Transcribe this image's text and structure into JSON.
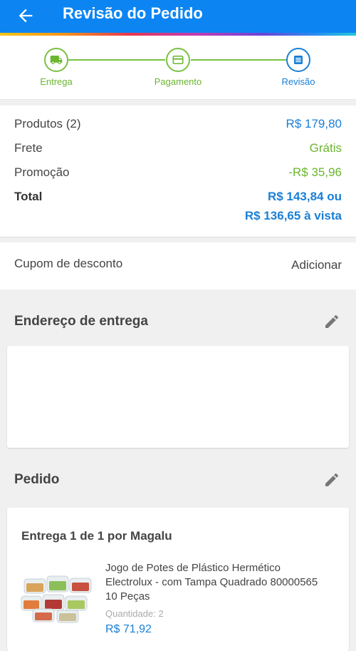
{
  "header": {
    "title": "Revisão do Pedido",
    "back_icon": "arrow-left-icon"
  },
  "steps": [
    {
      "label": "Entrega",
      "icon": "truck-icon",
      "state": "done"
    },
    {
      "label": "Pagamento",
      "icon": "credit-card-icon",
      "state": "done"
    },
    {
      "label": "Revisão",
      "icon": "list-icon",
      "state": "current"
    }
  ],
  "summary": {
    "products_label": "Produtos (2)",
    "products_value": "R$ 179,80",
    "shipping_label": "Frete",
    "shipping_value": "Grátis",
    "promo_label": "Promoção",
    "promo_value": "-R$ 35,96",
    "total_label": "Total",
    "total_value_line1": "R$ 143,84 ou",
    "total_value_line2": "R$ 136,65 à vista"
  },
  "coupon": {
    "label": "Cupom de desconto",
    "action": "Adicionar"
  },
  "address_section": {
    "title": "Endereço de entrega"
  },
  "order_section": {
    "title": "Pedido"
  },
  "order": {
    "delivery_title": "Entrega 1 de 1 por Magalu",
    "product_name": "Jogo de Potes de Plástico Hermético Electrolux - com Tampa Quadrado 80000565 10 Peças",
    "quantity": "Quantidade:  2",
    "price": "R$ 71,92"
  },
  "colors": {
    "primary": "#0c85f3",
    "accent_blue": "#1a7fd6",
    "accent_green": "#6bb52f"
  }
}
